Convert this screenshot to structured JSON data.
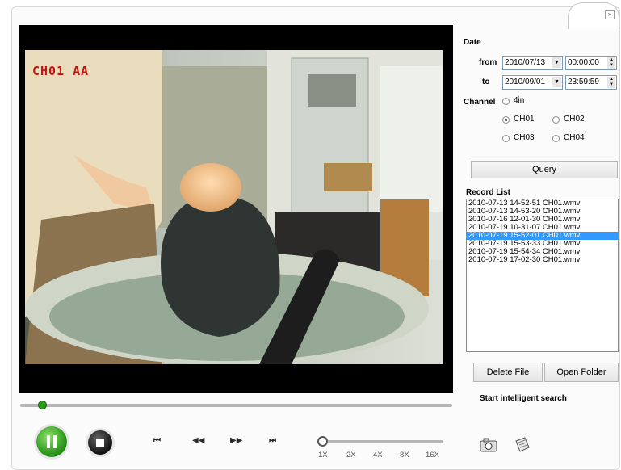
{
  "video": {
    "channel_label": "CH01  AA"
  },
  "search": {
    "date_label": "Date",
    "from_label": "from",
    "to_label": "to",
    "from_date": "2010/07/13",
    "from_time": "00:00:00",
    "to_date": "2010/09/01",
    "to_time": "23:59:59",
    "channel_label": "Channel",
    "channels": {
      "all": "4in",
      "ch01": "CH01",
      "ch02": "CH02",
      "ch03": "CH03",
      "ch04": "CH04"
    },
    "selected_channel": "CH01",
    "query_label": "Query"
  },
  "records": {
    "title": "Record List",
    "items": [
      "2010-07-13 14-52-51 CH01.wmv",
      "2010-07-13 14-53-20 CH01.wmv",
      "2010-07-16 12-01-30 CH01.wmv",
      "2010-07-19 10-31-07 CH01.wmv",
      "2010-07-19 15-52-01 CH01.wmv",
      "2010-07-19 15-53-33 CH01.wmv",
      "2010-07-19 15-54-34 CH01.wmv",
      "2010-07-19 17-02-30 CH01.wmv"
    ],
    "selected_index": 4
  },
  "actions": {
    "delete_label": "Delete File",
    "open_folder_label": "Open Folder",
    "intelligent_search_label": "Start intelligent search"
  },
  "playback": {
    "progress": 0.05,
    "speeds": [
      "1X",
      "2X",
      "4X",
      "8X",
      "16X"
    ],
    "selected_speed": "1X",
    "icons": {
      "play_pause": "pause-icon",
      "stop": "stop-icon",
      "first": "skip-first-icon",
      "rewind": "rewind-icon",
      "forward": "fast-forward-icon",
      "last": "skip-last-icon",
      "snapshot": "camera-icon",
      "clip": "clip-icon"
    }
  },
  "colors": {
    "accent_green": "#2e9a1e",
    "selection_blue": "#3399ff",
    "channel_label_red": "#cc1010"
  }
}
